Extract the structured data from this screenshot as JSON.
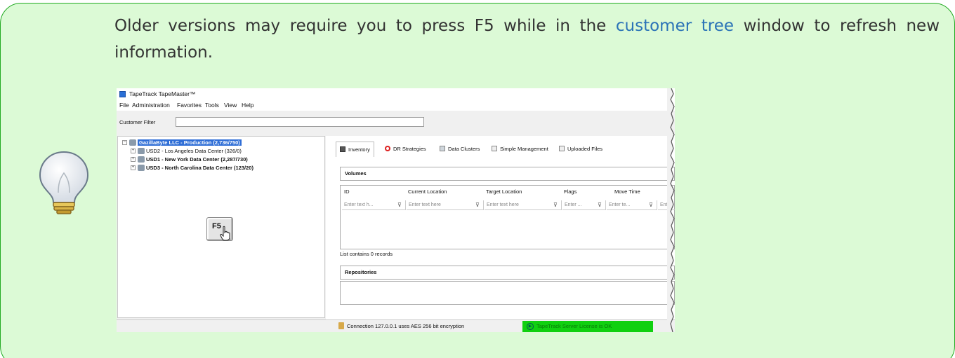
{
  "tip": {
    "text_before": "Older versions may require you to press F5 while in the ",
    "link_text": "customer tree",
    "text_after": " window to refresh new information."
  },
  "screenshot": {
    "app_title": "TapeTrack TapeMaster™",
    "menu": [
      "File",
      "Administration",
      "Favorites",
      "Tools",
      "View",
      "Help"
    ],
    "customer_filter_label": "Customer Filter",
    "customer_filter_value": "",
    "tree": [
      {
        "label": "GazillaByte LLC - Production (2,736/750)",
        "bold": true,
        "selected": true
      },
      {
        "label": "USD2 - Los Angeles Data Center (326/0)",
        "bold": false,
        "selected": false
      },
      {
        "label": "USD1 - New York Data Center (2,287/730)",
        "bold": true,
        "selected": false
      },
      {
        "label": "USD3 - North Carolina Data Center (123/20)",
        "bold": true,
        "selected": false
      }
    ],
    "f5_key_label": "F5",
    "tabs": [
      "Inventory",
      "DR Strategies",
      "Data Clusters",
      "Simple Management",
      "Uploaded Files"
    ],
    "volumes_header": "Volumes",
    "columns": [
      "ID",
      "Current Location",
      "Target Location",
      "Flags",
      "Move Time"
    ],
    "filter_placeholders": [
      "Enter text h...",
      "Enter text here",
      "Enter text here",
      "Enter ...",
      "Enter te...",
      "Ent"
    ],
    "list_status": "List contains 0 records",
    "repositories_header": "Repositories",
    "connection_status": "Connection 127.0.0.1 uses AES 256 bit encryption",
    "license_status": "TapeTrack Server License is OK"
  },
  "colors": {
    "tip_background": "#dcfad6",
    "tip_border": "#22aa22",
    "link": "#2b73b7",
    "license_ok": "#10d010"
  }
}
